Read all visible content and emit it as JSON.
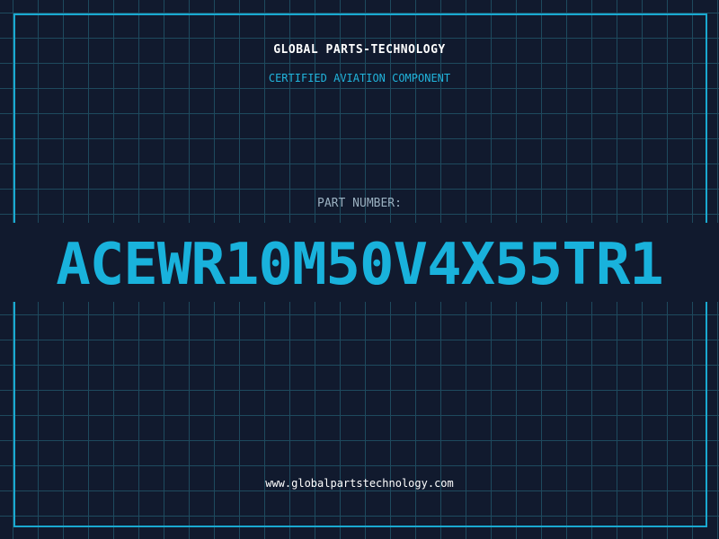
{
  "header": {
    "company": "GLOBAL PARTS-TECHNOLOGY",
    "tagline": "CERTIFIED AVIATION COMPONENT"
  },
  "part": {
    "label": "PART NUMBER:",
    "number": "ACEWR10M50V4X55TR1"
  },
  "footer": {
    "url": "www.globalpartstechnology.com"
  },
  "colors": {
    "background": "#111a2e",
    "grid": "#1e4a5e",
    "accent": "#19b2dc",
    "text": "#ffffff"
  }
}
